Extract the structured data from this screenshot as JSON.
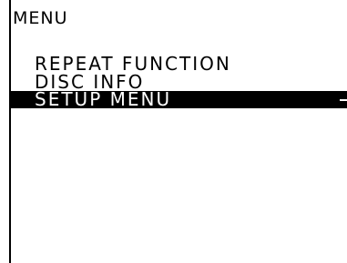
{
  "menu": {
    "title": "MENU",
    "items": [
      {
        "label": "REPEAT FUNCTION"
      },
      {
        "label": "DISC INFO"
      },
      {
        "label": "SETUP MENU",
        "selected": true
      }
    ],
    "colors": {
      "background": "#ffffff",
      "text": "#000000",
      "highlight": "#000000",
      "highlight_text": "#ffffff"
    }
  }
}
